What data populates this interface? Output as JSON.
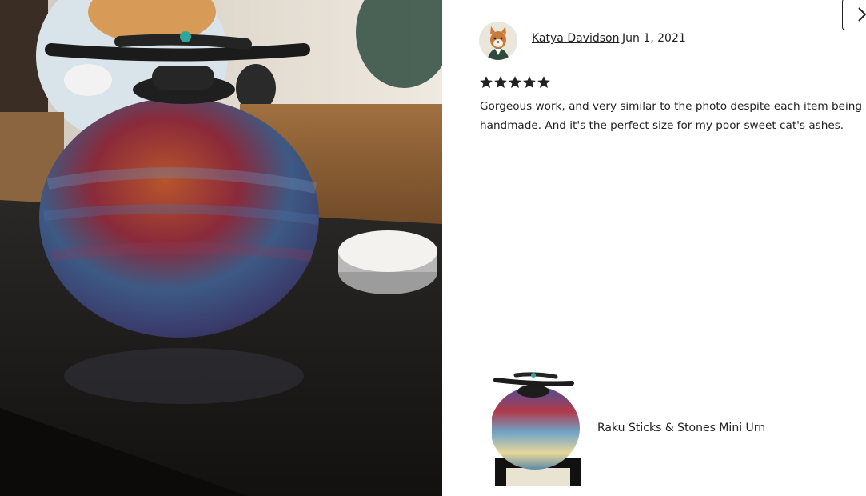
{
  "review": {
    "reviewer_name": "Katya Davidson",
    "date": "Jun 1, 2021",
    "rating": 5,
    "text": "Gorgeous work, and very similar to the photo despite each item being handmade. And it's the perfect size for my poor sweet cat's ashes."
  },
  "product": {
    "title": "Raku Sticks & Stones Mini Urn"
  },
  "icons": {
    "close": "chevron-right-icon",
    "star": "star-icon"
  },
  "colors": {
    "text": "#222222",
    "star": "#222222",
    "background": "#ffffff"
  }
}
